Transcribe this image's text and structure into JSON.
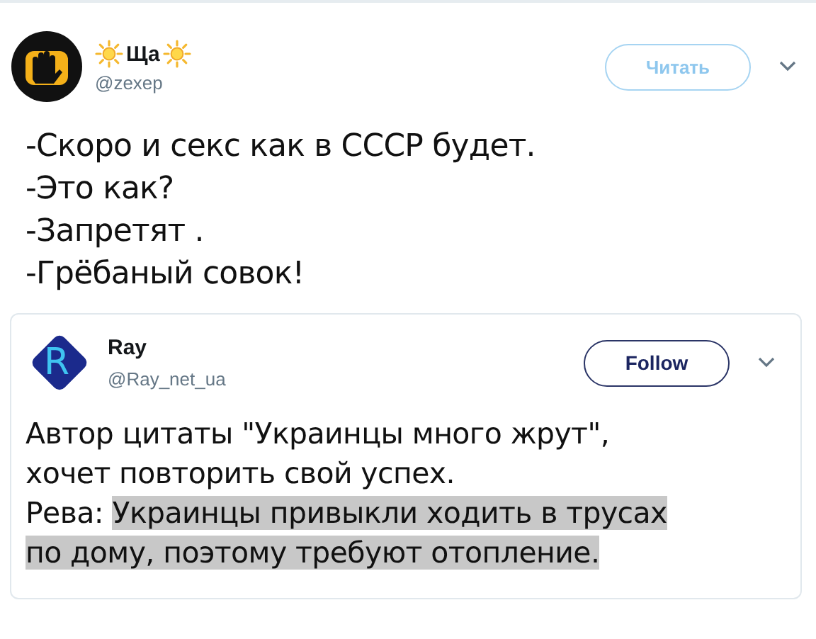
{
  "tweet": {
    "name": "Ща",
    "handle": "@zexep",
    "follow_button": "Читать",
    "lines": [
      "-Скоро и секс как в СССР будет.",
      "-Это как?",
      "-Запретят .",
      "-Грёбаный совок!"
    ],
    "quoted": {
      "avatar_letter": "R",
      "name": "Ray",
      "handle": "@Ray_net_ua",
      "follow_button": "Follow",
      "lines": [
        [
          {
            "text": "Автор цитаты \"Украинцы много жрут\",",
            "highlighted": false
          }
        ],
        [
          {
            "text": "хочет повторить свой успех.",
            "highlighted": false
          }
        ],
        [
          {
            "text": "Рева: ",
            "highlighted": false
          },
          {
            "text": "Украинцы привыкли ходить в трусах",
            "highlighted": true
          }
        ],
        [
          {
            "text": "по дому, поэтому требуют отопление.",
            "highlighted": true
          }
        ]
      ]
    }
  }
}
